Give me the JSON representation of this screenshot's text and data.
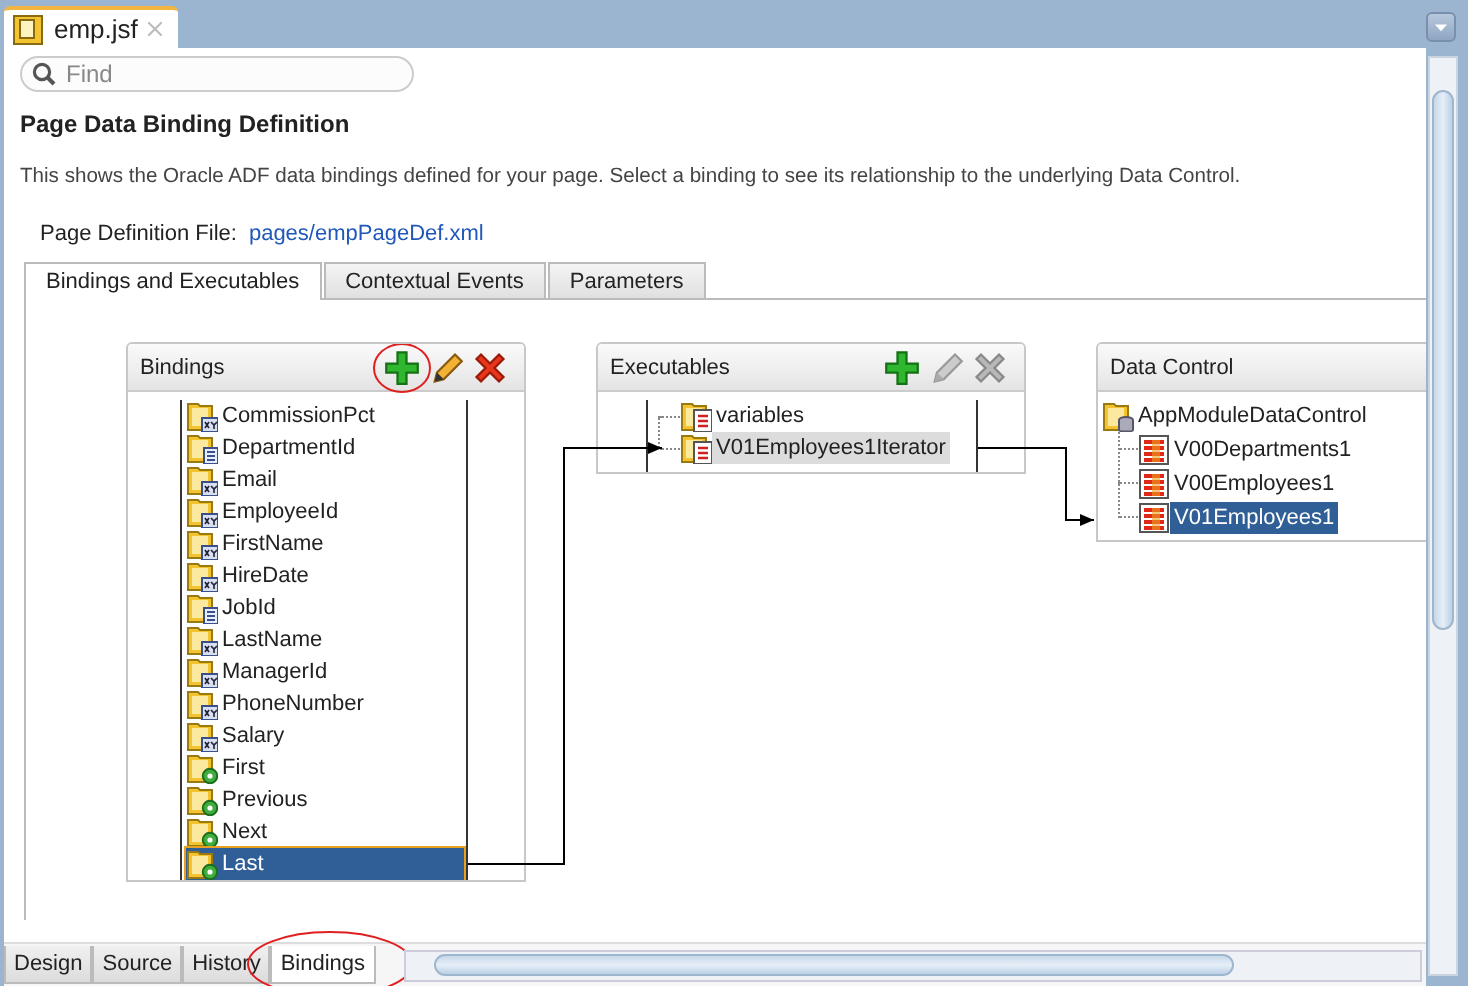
{
  "editor_tab": {
    "title": "emp.jsf",
    "selected": true
  },
  "search": {
    "placeholder": "Find"
  },
  "heading": "Page Data Binding Definition",
  "description": "This shows the Oracle ADF data bindings defined for your page. Select a binding to see its relationship to the underlying Data Control.",
  "page_definition": {
    "label": "Page Definition File:",
    "link": "pages/empPageDef.xml"
  },
  "tabs": [
    {
      "label": "Bindings and Executables",
      "selected": true
    },
    {
      "label": "Contextual Events",
      "selected": false
    },
    {
      "label": "Parameters",
      "selected": false
    }
  ],
  "bindings": {
    "title": "Bindings",
    "actions": [
      {
        "kind": "add",
        "disabled": false,
        "circled": true
      },
      {
        "kind": "edit",
        "disabled": false,
        "circled": false
      },
      {
        "kind": "delete",
        "disabled": false,
        "circled": false
      }
    ],
    "items": [
      {
        "label": "CommissionPct",
        "kind": "attribute",
        "selected": false
      },
      {
        "label": "DepartmentId",
        "kind": "list",
        "selected": false
      },
      {
        "label": "Email",
        "kind": "attribute",
        "selected": false
      },
      {
        "label": "EmployeeId",
        "kind": "attribute",
        "selected": false
      },
      {
        "label": "FirstName",
        "kind": "attribute",
        "selected": false
      },
      {
        "label": "HireDate",
        "kind": "attribute",
        "selected": false
      },
      {
        "label": "JobId",
        "kind": "list",
        "selected": false
      },
      {
        "label": "LastName",
        "kind": "attribute",
        "selected": false
      },
      {
        "label": "ManagerId",
        "kind": "attribute",
        "selected": false
      },
      {
        "label": "PhoneNumber",
        "kind": "attribute",
        "selected": false
      },
      {
        "label": "Salary",
        "kind": "attribute",
        "selected": false
      },
      {
        "label": "First",
        "kind": "action",
        "selected": false
      },
      {
        "label": "Previous",
        "kind": "action",
        "selected": false
      },
      {
        "label": "Next",
        "kind": "action",
        "selected": false
      },
      {
        "label": "Last",
        "kind": "action",
        "selected": true
      }
    ]
  },
  "executables": {
    "title": "Executables",
    "actions": [
      {
        "kind": "add",
        "disabled": false,
        "circled": false
      },
      {
        "kind": "edit",
        "disabled": true,
        "circled": false
      },
      {
        "kind": "delete",
        "disabled": true,
        "circled": false
      }
    ],
    "items": [
      {
        "label": "variables",
        "selected": false
      },
      {
        "label": "V01Employees1Iterator",
        "selected": true
      }
    ]
  },
  "data_control": {
    "title": "Data Control",
    "root": {
      "label": "AppModuleDataControl",
      "children": [
        {
          "label": "V00Departments1",
          "selected": false
        },
        {
          "label": "V00Employees1",
          "selected": false
        },
        {
          "label": "V01Employees1",
          "selected": true
        }
      ]
    }
  },
  "bottom_tabs": [
    {
      "label": "Design",
      "selected": false,
      "circled": false
    },
    {
      "label": "Source",
      "selected": false,
      "circled": false
    },
    {
      "label": "History",
      "selected": false,
      "circled": false
    },
    {
      "label": "Bindings",
      "selected": true,
      "circled": true
    }
  ]
}
